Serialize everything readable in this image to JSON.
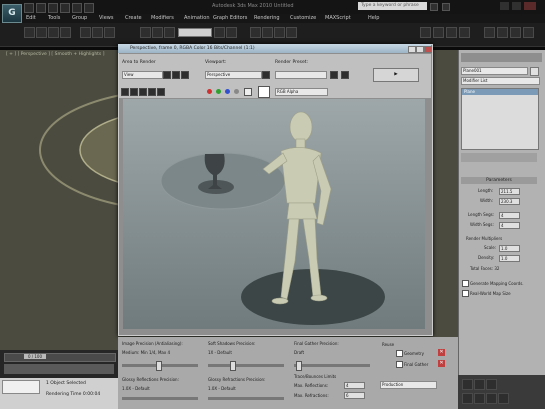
{
  "app": {
    "title": "Autodesk 3ds Max 2010 Untitled",
    "logo_text": "G",
    "search_placeholder": "Type a keyword or phrase"
  },
  "menu": [
    "Edit",
    "Tools",
    "Group",
    "Views",
    "Create",
    "Modifiers",
    "Animation",
    "Graph Editors",
    "Rendering",
    "Customize",
    "MAXScript",
    "Help"
  ],
  "viewport": {
    "label": "[ + ] [ Perspective ] [ Smooth + Highlights ]"
  },
  "render_window": {
    "title": "Perspective, frame 0, RGBA Color 16 Bits/Channel (1:1)",
    "area_to_render_label": "Area to Render",
    "area_to_render_value": "View",
    "viewport_label": "Viewport:",
    "viewport_value": "Perspective",
    "render_preset_label": "Render Preset:",
    "channel_value": "RGB Alpha"
  },
  "command_panel": {
    "object_name": "Plane001",
    "modifier_list": "Modifier List",
    "stack_item": "Plane",
    "parameters_title": "Parameters",
    "params": [
      {
        "label": "Length:",
        "value": "211.5"
      },
      {
        "label": "Width:",
        "value": "230.3"
      },
      {
        "label": "Length Segs:",
        "value": "4"
      },
      {
        "label": "Width Segs:",
        "value": "4"
      }
    ],
    "render_mult_label": "Render Multipliers",
    "scale_label": "Scale:",
    "scale_value": "1.0",
    "density_label": "Density:",
    "density_value": "1.0",
    "total_faces": "Total Faces: 32",
    "gen_mapping": "Generate Mapping Coords.",
    "real_world": "Real-World Map Size"
  },
  "bottom_panel": {
    "image_precision_label": "Image Precision (Antialiasing):",
    "image_precision_value": "Medium: Min 1/4, Max 4",
    "soft_shadows_label": "Soft Shadows Precision:",
    "soft_shadows_value": "1X - Default",
    "final_gather_label": "Final Gather Precision:",
    "final_gather_value": "Draft",
    "reuse_label": "Reuse",
    "geometry_label": "Geometry",
    "final_gather_chk": "Final Gather",
    "glossy_refl_label": "Glossy Reflections Precision:",
    "glossy_refl_value": "1.0X - Default",
    "glossy_refr_label": "Glossy Refractions Precision:",
    "glossy_refr_value": "1.0X - Default",
    "trace_label": "Trace/Bounces Limits",
    "max_refl_label": "Max. Reflections:",
    "max_refl_value": "4",
    "max_refr_label": "Max. Refractions:",
    "max_refr_value": "6",
    "production_value": "Production"
  },
  "status": {
    "frame_counter": "0 / 100",
    "selected": "1 Object Selected",
    "rendering_time": "Rendering Time 0:00:04"
  }
}
